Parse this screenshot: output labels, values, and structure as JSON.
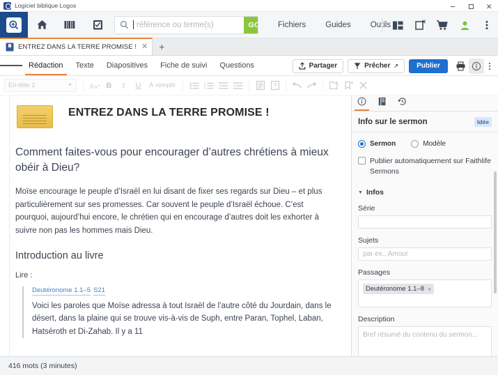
{
  "window": {
    "title": "Logiciel biblique Logos",
    "app_icon": "logos-app-icon",
    "minimize": "minimize-icon",
    "maximize": "maximize-icon",
    "close": "close-icon"
  },
  "navbar": {
    "logo_icon": "logos-search-badge-icon",
    "icons": [
      {
        "name": "home-icon",
        "label": "Accueil"
      },
      {
        "name": "library-icon",
        "label": "Bibliothèque"
      },
      {
        "name": "reading-plan-icon",
        "label": "Plans de lecture"
      }
    ],
    "search": {
      "placeholder": "référence ou terme(s)",
      "value": "",
      "icon": "search-icon",
      "go_label": "GO"
    },
    "menus": [
      "Fichiers",
      "Guides",
      "Outils"
    ],
    "right_icons": [
      {
        "name": "layout-icon"
      },
      {
        "name": "close-all-windows-icon"
      },
      {
        "name": "cart-icon"
      },
      {
        "name": "account-icon",
        "color": "#7bc043"
      },
      {
        "name": "kebab-menu-icon"
      }
    ]
  },
  "tabstrip": {
    "tab": {
      "icon": "sermon-document-icon",
      "label": "ENTREZ DANS LA TERRE PROMISE !",
      "close_icon": "close-icon"
    },
    "add_tab": "+"
  },
  "panelbar": {
    "menu_icon": "hamburger-icon",
    "tabs": [
      {
        "label": "Rédaction",
        "active": true
      },
      {
        "label": "Texte",
        "active": false
      },
      {
        "label": "Diapositives",
        "active": false
      },
      {
        "label": "Fiche de suivi",
        "active": false
      },
      {
        "label": "Questions",
        "active": false
      }
    ],
    "share_label": "Partager",
    "share_icon": "share-upload-icon",
    "preach_label": "Prêcher",
    "preach_icon": "preach-podium-icon",
    "preach_external_icon": "external-link-icon",
    "publish_label": "Publier",
    "print_icon": "printer-icon",
    "info_icon": "info-circle-icon",
    "more_icon": "kebab-menu-icon"
  },
  "formatbar": {
    "style_value": "En-tête 2",
    "style_caret": "chevron-down-icon",
    "font_size_icon": "font-size-icon",
    "bold": "B",
    "italic": "I",
    "underline": "U",
    "fill_label": "À remplir",
    "bullet_list_icon": "bullet-list-icon",
    "numbered_list_icon": "numbered-list-icon",
    "outdent_icon": "outdent-icon",
    "indent_icon": "indent-icon",
    "note_icon": "note-icon",
    "question_icon": "question-box-icon",
    "undo_icon": "undo-icon",
    "redo_icon": "redo-icon",
    "insert_slide_icon": "insert-slide-icon",
    "insert_bookmark_icon": "insert-bookmark-icon",
    "clear_format_icon": "clear-formatting-icon"
  },
  "document": {
    "thumbnail": "sermon-slide-thumbnail",
    "title": "ENTREZ DANS LA TERRE PROMISE !",
    "heading_question": "Comment faites-vous pour encourager d’autres chrétiens à mieux obéir à Dieu?",
    "paragraph": "Moïse encourage le peuple d’Israël en lui disant de fixer ses regards sur Dieu – et plus particulièrement sur ses promesses. Car souvent le peuple d’Israël échoue. C’est pourquoi, aujourd’hui encore, le chrétien qui en encourage d’autres doit les exhorter à suivre non pas les hommes mais Dieu.",
    "section_heading": "Introduction au livre",
    "lead": "Lire :",
    "quote_reference": "Deutéronome 1.1–5",
    "quote_version": "S21",
    "quote_text": "Voici les paroles que Moïse adressa à tout Israël de l’autre côté du Jourdain, dans le désert, dans la plaine qui se trouve vis-à-vis de Suph, entre Paran, Tophel, Laban, Hatséroth et Di-Zahab. Il y a 11"
  },
  "sidebar": {
    "tabs": [
      {
        "name": "info-tab",
        "icon": "info-circle-icon",
        "active": true
      },
      {
        "name": "outline-tab",
        "icon": "book-outline-icon",
        "active": false
      },
      {
        "name": "history-tab",
        "icon": "history-clock-icon",
        "active": false
      }
    ],
    "title": "Info sur le sermon",
    "badge": "Idée",
    "radio_sermon": "Sermon",
    "radio_template": "Modèle",
    "radio_selected": "Sermon",
    "autopublish_label": "Publier automatiquement sur Faithlife Sermons",
    "autopublish_checked": false,
    "infos_section": "Infos",
    "fields": [
      {
        "label": "Série",
        "value": "",
        "placeholder": ""
      },
      {
        "label": "Sujets",
        "value": "",
        "placeholder": "par ex., Amour"
      },
      {
        "label": "Passages",
        "chip": "Deutéronome 1.1–8",
        "chip_remove": "×"
      },
      {
        "label": "Description",
        "value": "",
        "placeholder": "Bref résumé du contenu du sermon..."
      }
    ]
  },
  "statusbar": {
    "word_count": "416 mots (3 minutes)"
  }
}
